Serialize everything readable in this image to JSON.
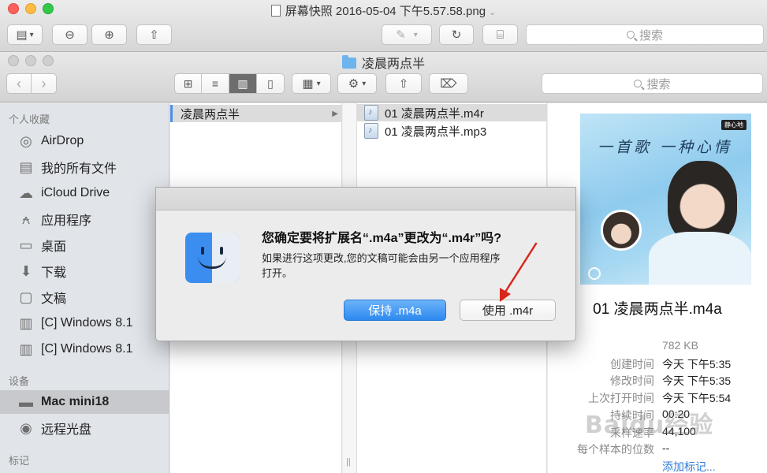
{
  "preview_window": {
    "title": "屏幕快照 2016-05-04 下午5.57.58.png",
    "search_placeholder": "搜索",
    "toolbar_icons": [
      "sidebar-toggle-icon",
      "zoom-out-icon",
      "zoom-in-icon",
      "share-icon",
      "markup-pen-icon",
      "rotate-icon",
      "toolbox-icon"
    ]
  },
  "finder": {
    "title": "凌晨两点半",
    "search_placeholder": "搜索",
    "toolbar_icons": [
      "back-icon",
      "forward-icon",
      "icon-view-icon",
      "list-view-icon",
      "column-view-icon",
      "coverflow-view-icon",
      "arrange-icon",
      "action-gear-icon",
      "share-icon",
      "tag-icon"
    ],
    "selected_view": "column"
  },
  "sidebar": {
    "favorites_header": "个人收藏",
    "favorites": [
      {
        "label": "AirDrop",
        "icon": "airdrop-icon"
      },
      {
        "label": "我的所有文件",
        "icon": "all-files-icon"
      },
      {
        "label": "iCloud Drive",
        "icon": "icloud-icon"
      },
      {
        "label": "应用程序",
        "icon": "applications-icon"
      },
      {
        "label": "桌面",
        "icon": "desktop-icon"
      },
      {
        "label": "下载",
        "icon": "downloads-icon"
      },
      {
        "label": "文稿",
        "icon": "documents-icon"
      },
      {
        "label": "[C] Windows 8.1",
        "icon": "disk-icon"
      },
      {
        "label": "[C] Windows 8.1",
        "icon": "disk-icon"
      }
    ],
    "devices_header": "设备",
    "devices": [
      {
        "label": "Mac mini18",
        "icon": "mac-mini-icon",
        "selected": true
      },
      {
        "label": "远程光盘",
        "icon": "optical-disc-icon"
      }
    ],
    "tags_header": "标记"
  },
  "columns": {
    "col1": [
      {
        "label": "凌晨两点半",
        "has_children": true
      }
    ],
    "col2": [
      {
        "label": "01 凌晨两点半.m4r",
        "selected": true
      },
      {
        "label": "01 凌晨两点半.mp3",
        "selected": false
      }
    ]
  },
  "preview": {
    "artwork_text": "一首歌 一种心情",
    "artwork_badge": "静心地",
    "file_name": "01 凌晨两点半.m4a",
    "file_size": "782 KB",
    "meta": [
      {
        "key": "创建时间",
        "value": "今天 下午5:35"
      },
      {
        "key": "修改时间",
        "value": "今天 下午5:35"
      },
      {
        "key": "上次打开时间",
        "value": "今天 下午5:54"
      },
      {
        "key": "持续时间",
        "value": "00:20"
      },
      {
        "key": "采样速率",
        "value": "44,100"
      },
      {
        "key": "每个样本的位数",
        "value": "--"
      }
    ],
    "add_tag": "添加标记..."
  },
  "dialog": {
    "title": "您确定要将扩展名“.m4a”更改为“.m4r”吗?",
    "body": "如果进行这项更改,您的文稿可能会由另一个应用程序打开。",
    "keep_button": "保持 .m4a",
    "use_button": "使用 .m4r"
  },
  "watermark": "Baidu经验",
  "colors": {
    "accent": "#2d89ef",
    "sidebar_bg": "#e1e5ea",
    "annotation_arrow": "#d9261c"
  }
}
